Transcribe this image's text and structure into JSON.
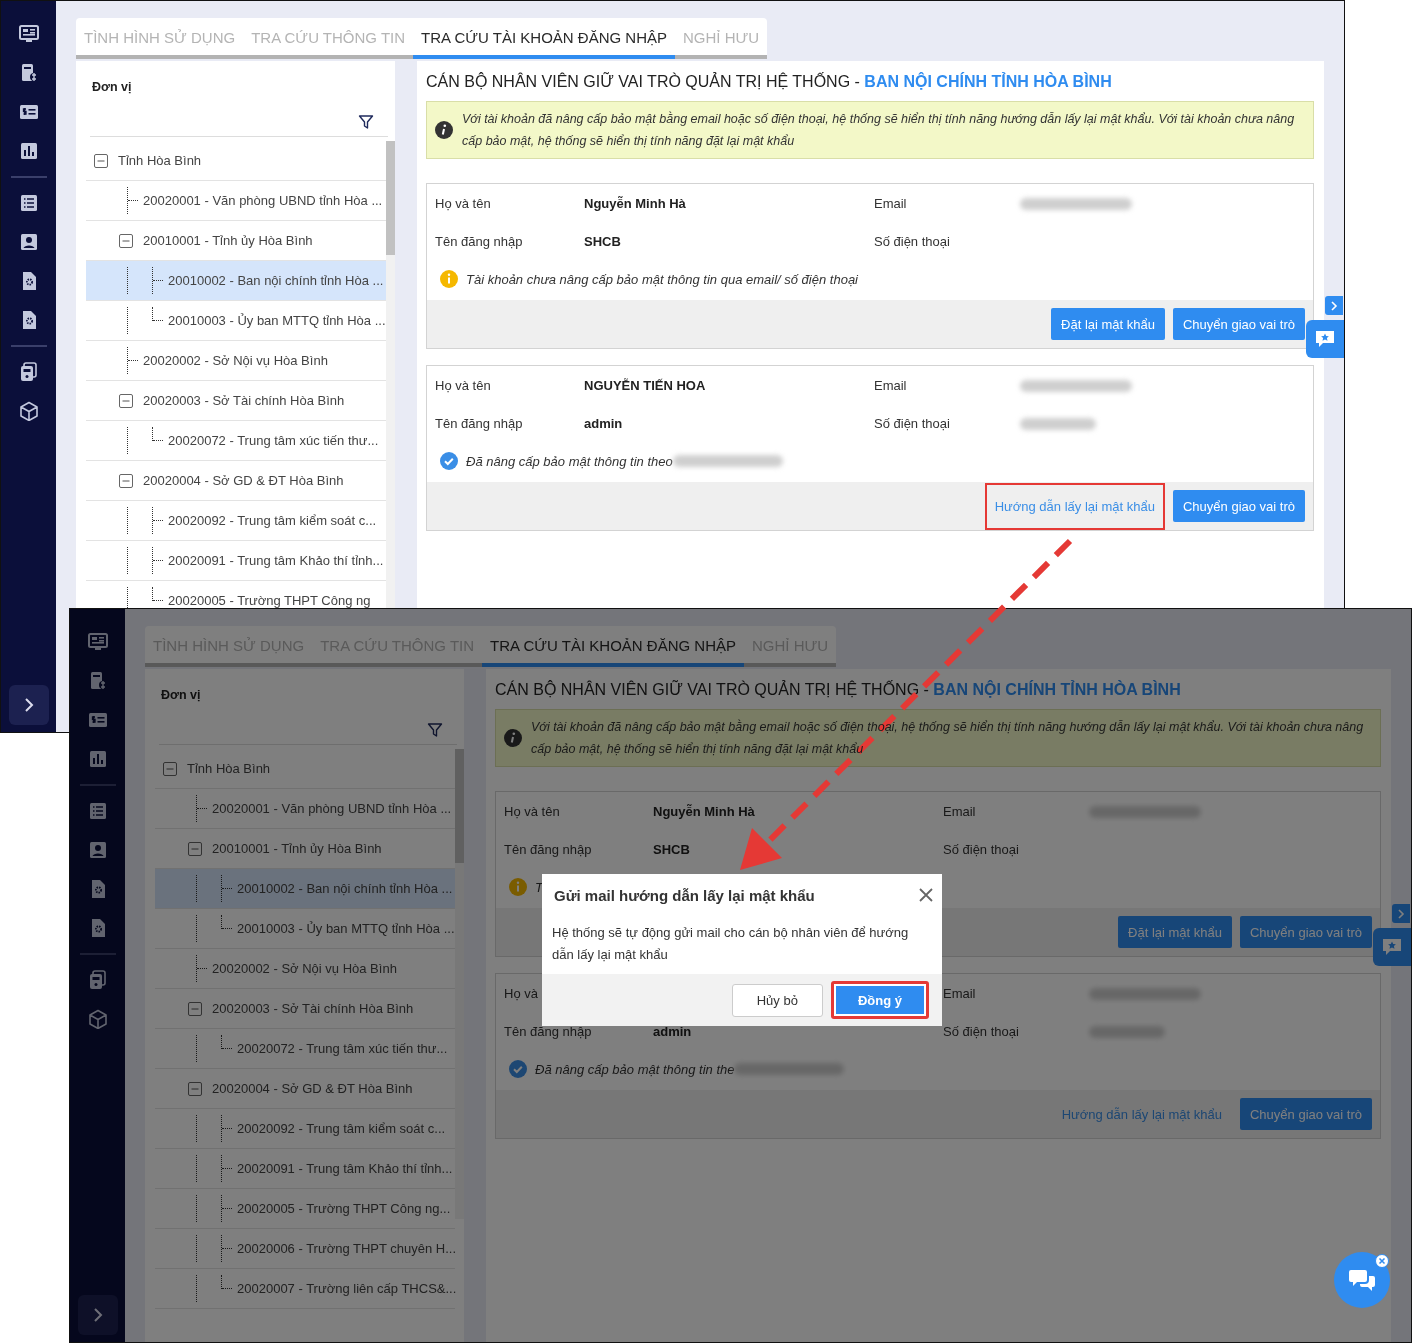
{
  "screens": [
    {
      "tabs": [
        {
          "label": "TÌNH HÌNH SỬ DỤNG",
          "selected": false
        },
        {
          "label": "TRA CỨU THÔNG TIN",
          "selected": false
        },
        {
          "label": "TRA CỨU TÀI KHOẢN ĐĂNG NHẬP",
          "selected": true
        },
        {
          "label": "NGHỈ HƯU",
          "selected": false
        }
      ],
      "unit_label": "Đơn vị",
      "tree": [
        {
          "label": "Tỉnh Hòa Bình",
          "selected": false,
          "expanded": true,
          "children": [
            {
              "label": "20020001 - Văn phòng UBND tỉnh Hòa ...",
              "selected": false
            },
            {
              "label": "20010001 - Tỉnh ủy Hòa Bình",
              "selected": false,
              "expanded": true,
              "children": [
                {
                  "label": "20010002 - Ban nội chính tỉnh Hòa ...",
                  "selected": true
                },
                {
                  "label": "20010003 - Ủy ban MTTQ tỉnh Hòa ...",
                  "selected": false
                }
              ]
            },
            {
              "label": "20020002 - Sở Nội vụ Hòa Bình",
              "selected": false
            },
            {
              "label": "20020003 - Sở Tài chính Hòa Bình",
              "selected": false,
              "expanded": true,
              "children": [
                {
                  "label": "20020072 - Trung tâm xúc tiến thư...",
                  "selected": false
                }
              ]
            },
            {
              "label": "20020004 - Sở GD & ĐT Hòa Bình",
              "selected": false,
              "expanded": true,
              "children": [
                {
                  "label": "20020092 - Trung tâm kiểm soát c...",
                  "selected": false
                },
                {
                  "label": "20020091 - Trung tâm Khảo thí tỉnh...",
                  "selected": false
                },
                {
                  "label": "20020005 - Trường THPT Công ng",
                  "selected": false
                }
              ]
            }
          ]
        }
      ],
      "heading": {
        "title": "CÁN BỘ NHÂN VIÊN GIỮ VAI TRÒ QUẢN TRỊ HỆ THỐNG -",
        "unit": "BAN NỘI CHÍNH TỈNH HÒA BÌNH"
      },
      "notice": "Với tài khoản đã nâng cấp bảo mật bằng email hoặc số điện thoại, hệ thống sẽ hiển thị tính năng hướng dẫn lấy lại mật khẩu. Với tài khoản chưa nâng cấp bảo mật, hệ thống sẽ hiển thị tính năng đặt lại mật khẩu",
      "accounts": [
        {
          "name_label": "Họ và tên",
          "name": "Nguyễn Minh Hà",
          "email_label": "Email",
          "email_blurred": true,
          "login_label": "Tên đăng nhập",
          "login": "SHCB",
          "phone_label": "Số điện thoại",
          "status": {
            "kind": "warning",
            "text": "Tài khoản chưa nâng cấp bảo mật thông tin qua email/ số điện thoại"
          },
          "actions": [
            {
              "label": "Đặt lại mật khẩu",
              "kind": "button",
              "highlighted": false
            },
            {
              "label": "Chuyển giao vai trò",
              "kind": "button",
              "highlighted": false
            }
          ]
        },
        {
          "name_label": "Họ và tên",
          "name": "NGUYỄN TIẾN HOA",
          "email_label": "Email",
          "email_blurred": true,
          "login_label": "Tên đăng nhập",
          "login": "admin",
          "phone_label": "Số điện thoại",
          "phone_blurred": true,
          "status": {
            "kind": "verified",
            "text": "Đã nâng cấp bảo mật thông tin theo",
            "email_blurred": true
          },
          "actions": [
            {
              "label": "Hướng dẫn lấy lại mật khẩu",
              "kind": "link",
              "highlighted": true
            },
            {
              "label": "Chuyển giao vai trò",
              "kind": "button",
              "highlighted": false
            }
          ]
        }
      ]
    },
    {
      "tabs": [
        {
          "label": "TÌNH HÌNH SỬ DỤNG",
          "selected": false
        },
        {
          "label": "TRA CỨU THÔNG TIN",
          "selected": false
        },
        {
          "label": "TRA CỨU TÀI KHOẢN ĐĂNG NHẬP",
          "selected": true
        },
        {
          "label": "NGHỈ HƯU",
          "selected": false
        }
      ],
      "unit_label": "Đơn vị",
      "tree": [
        {
          "label": "Tỉnh Hòa Bình",
          "selected": false,
          "expanded": true,
          "children": [
            {
              "label": "20020001 - Văn phòng UBND tỉnh Hòa ...",
              "selected": false
            },
            {
              "label": "20010001 - Tỉnh ủy Hòa Bình",
              "selected": false,
              "expanded": true,
              "children": [
                {
                  "label": "20010002 - Ban nội chính tỉnh Hòa ...",
                  "selected": true
                },
                {
                  "label": "20010003 - Ủy ban MTTQ tỉnh Hòa ...",
                  "selected": false
                }
              ]
            },
            {
              "label": "20020002 - Sở Nội vụ Hòa Bình",
              "selected": false
            },
            {
              "label": "20020003 - Sở Tài chính Hòa Bình",
              "selected": false,
              "expanded": true,
              "children": [
                {
                  "label": "20020072 - Trung tâm xúc tiến thư...",
                  "selected": false
                }
              ]
            },
            {
              "label": "20020004 - Sở GD & ĐT Hòa Bình",
              "selected": false,
              "expanded": true,
              "children": [
                {
                  "label": "20020092 - Trung tâm kiểm soát c...",
                  "selected": false
                },
                {
                  "label": "20020091 - Trung tâm Khảo thí tỉnh...",
                  "selected": false
                },
                {
                  "label": "20020005 - Trường THPT Công ng...",
                  "selected": false
                },
                {
                  "label": "20020006 - Trường THPT chuyên H...",
                  "selected": false
                },
                {
                  "label": "20020007 - Trường liên cấp THCS&...",
                  "selected": false
                }
              ]
            }
          ]
        }
      ],
      "heading": {
        "title": "CÁN BỘ NHÂN VIÊN GIỮ VAI TRÒ QUẢN TRỊ HỆ THỐNG -",
        "unit": "BAN NỘI CHÍNH TỈNH HÒA BÌNH"
      },
      "notice": "Với tài khoản đã nâng cấp bảo mật bằng email hoặc số điện thoại, hệ thống sẽ hiển thị tính năng hướng dẫn lấy lại mật khẩu. Với tài khoản chưa nâng cấp bảo mật, hệ thống sẽ hiển thị tính năng đặt lại mật khẩu",
      "accounts": [
        {
          "name_label": "Họ và tên",
          "name": "Nguyễn Minh Hà",
          "email_label": "Email",
          "email_blurred": true,
          "login_label": "Tên đăng nhập",
          "login": "SHCB",
          "phone_label": "Số điện thoại",
          "status": {
            "kind": "warning",
            "text": "T"
          },
          "actions": [
            {
              "label": "Đặt lại mật khẩu",
              "kind": "button",
              "highlighted": false
            },
            {
              "label": "Chuyển giao vai trò",
              "kind": "button",
              "highlighted": false
            }
          ]
        },
        {
          "name_label": "Họ và",
          "email_label": "Email",
          "email_blurred": true,
          "login_label": "Tên đăng nhập",
          "login": "admin",
          "phone_label": "Số điện thoại",
          "phone_blurred": true,
          "status": {
            "kind": "verified",
            "text": "Đã nâng cấp bảo mật thông tin the",
            "email_blurred": true
          },
          "actions": [
            {
              "label": "Hướng dẫn lấy lại mật khẩu",
              "kind": "link",
              "highlighted": false
            },
            {
              "label": "Chuyển giao vai trò",
              "kind": "button",
              "highlighted": false
            }
          ]
        }
      ],
      "dialog": {
        "title": "Gửi mail hướng dẫn lấy lại mật khẩu",
        "message": "Hệ thống sẽ tự động gửi mail cho cán bộ nhân viên để hướng dẫn lấy lại mật khẩu",
        "buttons": [
          {
            "label": "Hủy bỏ",
            "kind": "secondary",
            "highlighted": false
          },
          {
            "label": "Đồng ý",
            "kind": "primary",
            "highlighted": true
          }
        ]
      },
      "chat_button": true
    }
  ]
}
